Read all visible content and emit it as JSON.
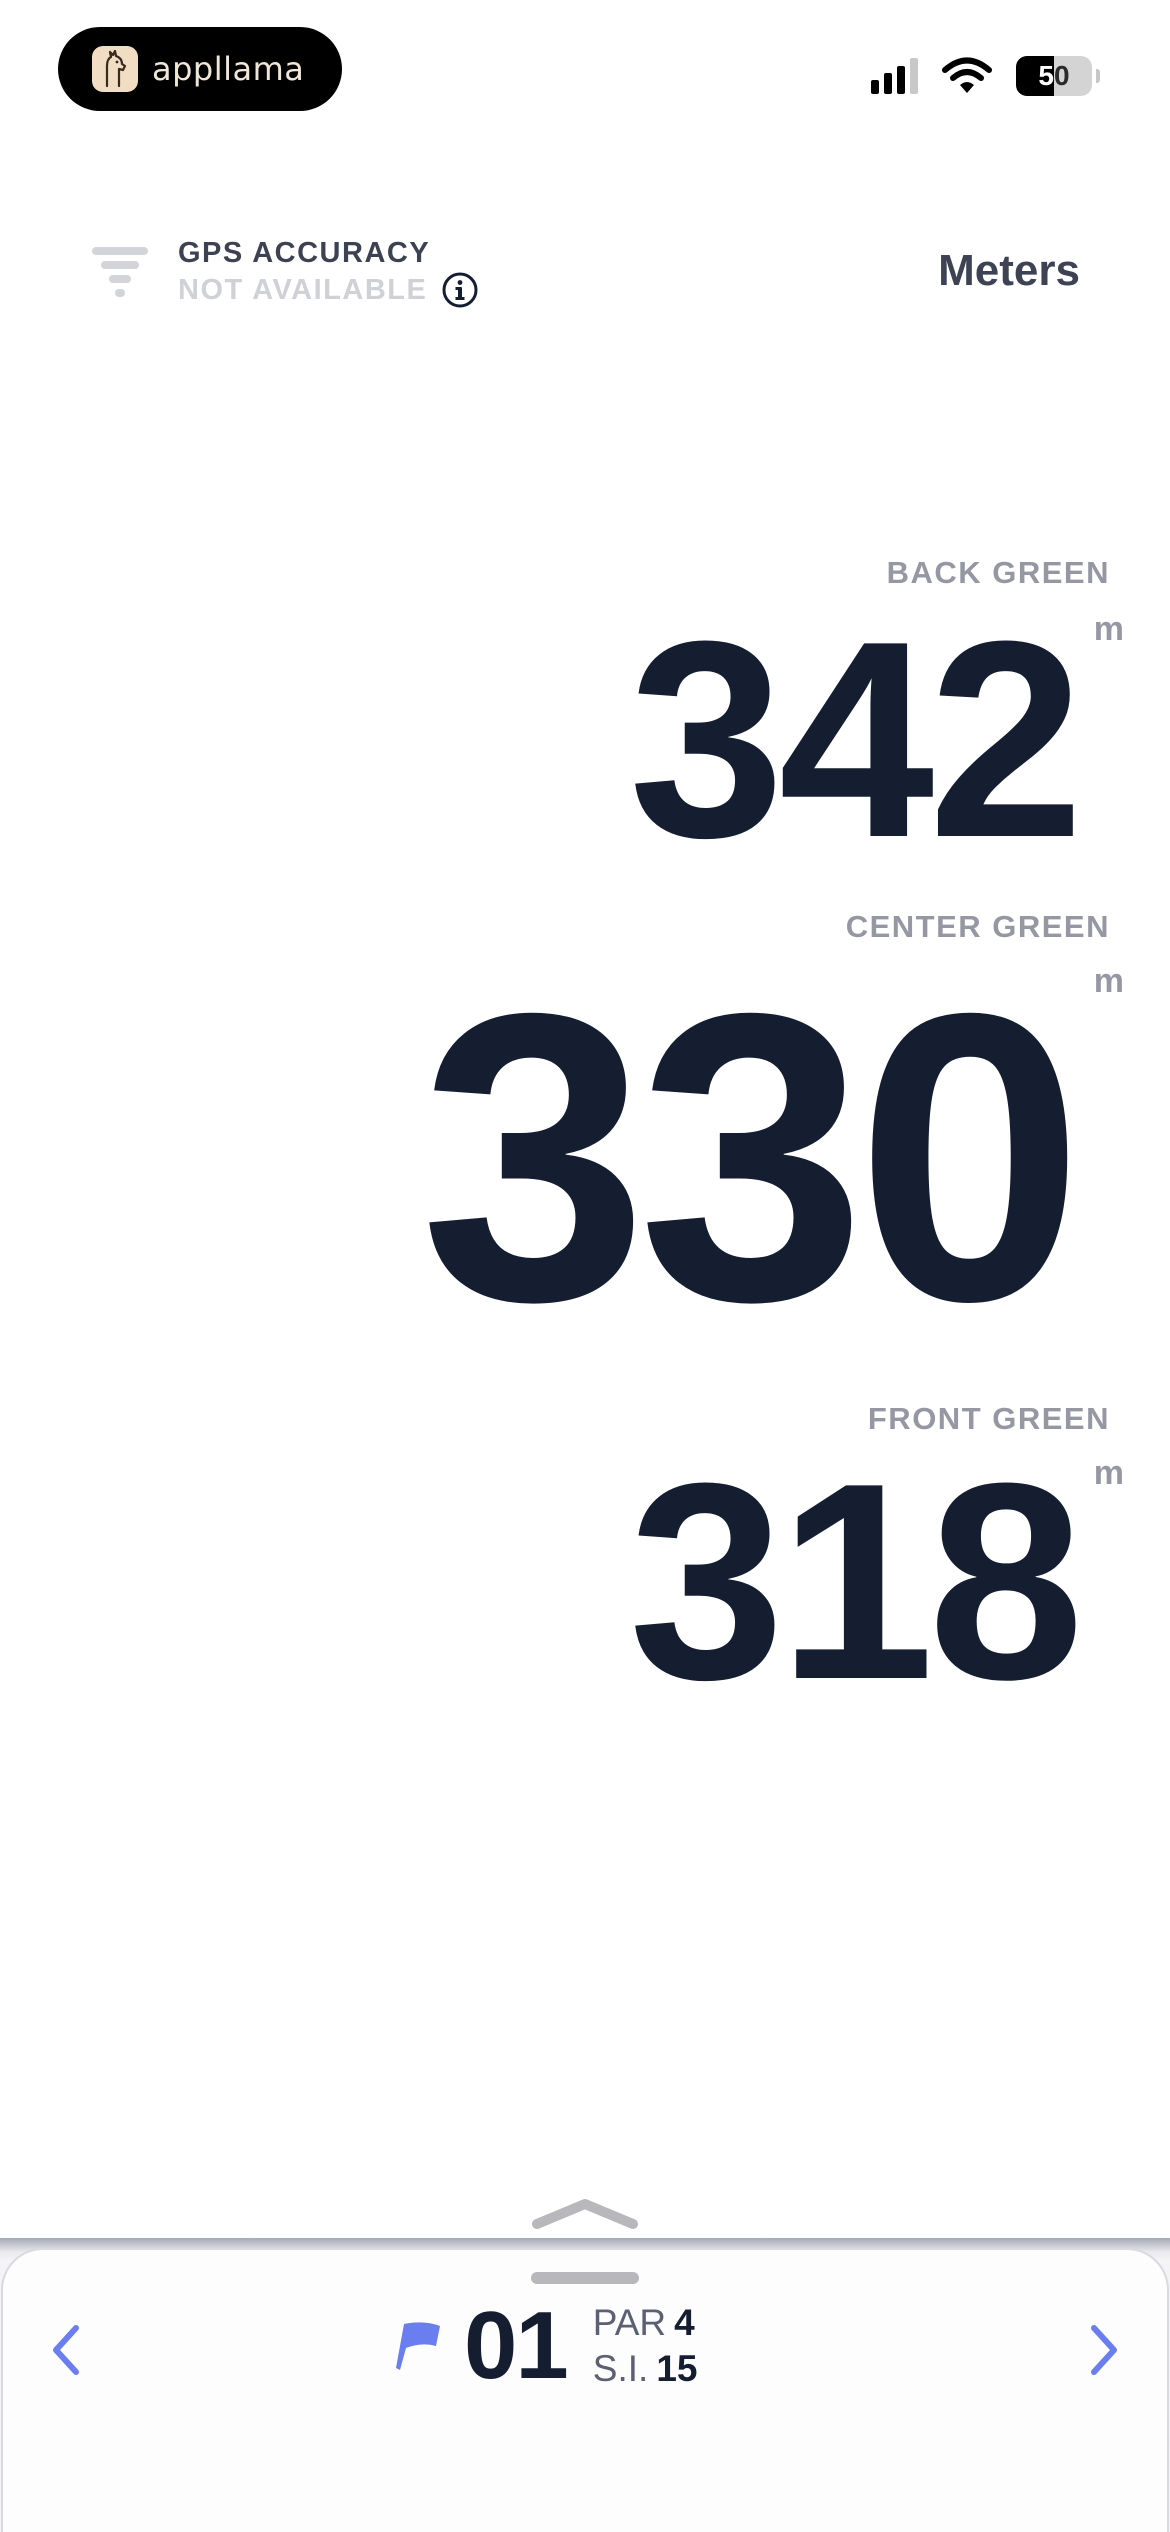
{
  "status_bar": {
    "app_name": "appllama",
    "battery_percent": 50,
    "battery_label": "50",
    "signal_bars_active": 3,
    "signal_bars_total": 4,
    "icons": [
      "llama-logo-icon",
      "cellular-signal-icon",
      "wifi-icon",
      "battery-icon"
    ]
  },
  "gps": {
    "title": "GPS ACCURACY",
    "status": "NOT AVAILABLE",
    "icons": [
      "gps-accuracy-icon",
      "info-icon"
    ]
  },
  "units": {
    "label": "Meters"
  },
  "distances": {
    "back": {
      "label": "BACK GREEN",
      "value": "342",
      "unit": "m"
    },
    "center": {
      "label": "CENTER GREEN",
      "value": "330",
      "unit": "m"
    },
    "front": {
      "label": "FRONT GREEN",
      "value": "318",
      "unit": "m"
    }
  },
  "hole": {
    "number": "01",
    "par_label": "PAR",
    "par_value": "4",
    "si_label": "S.I.",
    "si_value": "15",
    "icons": [
      "flag-icon",
      "chevron-left-icon",
      "chevron-right-icon",
      "chevron-up-icon"
    ]
  },
  "colors": {
    "text_dark": "#151e31",
    "label_gray": "#9598a3",
    "accent_blue": "#6a7ef0",
    "disabled_gray": "#cfd1d6"
  }
}
